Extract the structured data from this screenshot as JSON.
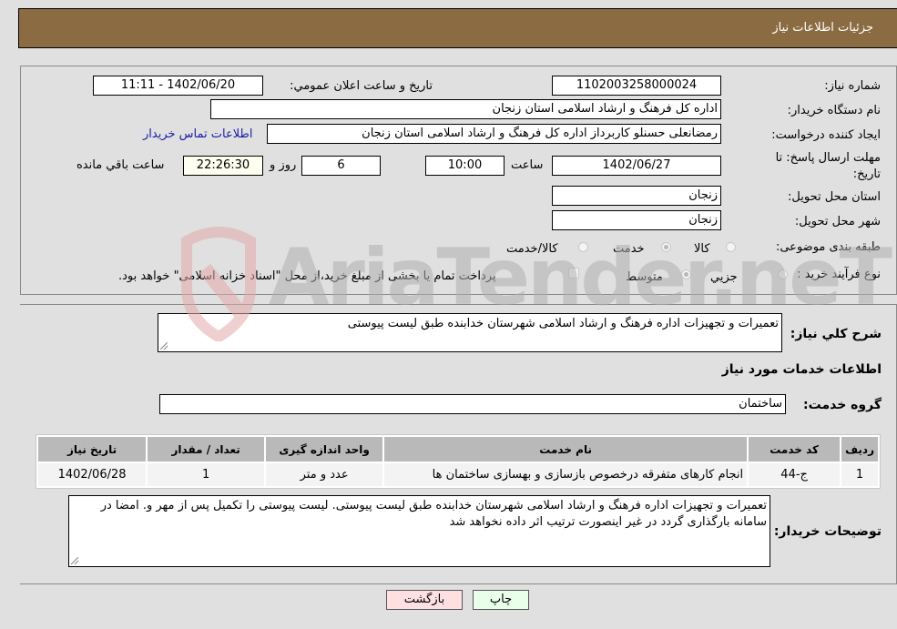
{
  "header": {
    "title": "جزئیات اطلاعات نیاز"
  },
  "form": {
    "need_number": {
      "label": "شماره نیاز:",
      "value": "1102003258000024"
    },
    "announce_datetime": {
      "label": "تاریخ و ساعت اعلان عمومي:",
      "value": "1402/06/20 - 11:11"
    },
    "buyer_org": {
      "label": "نام دستگاه خریدار:",
      "value": "اداره کل فرهنگ و ارشاد اسلامی استان زنجان"
    },
    "requester": {
      "label": "ایجاد کننده درخواست:",
      "value": "رمضانعلی حسنلو کاربرداز اداره کل فرهنگ و ارشاد اسلامی استان زنجان"
    },
    "buyer_contact_link": "اطلاعات تماس خریدار",
    "deadline": {
      "label": "مهلت ارسال پاسخ: تا تاریخ:",
      "date": "1402/06/27",
      "time_label": "ساعت",
      "time": "10:00",
      "days": "6",
      "days_label": "روز و",
      "remaining": "22:26:30",
      "remaining_label": "ساعت باقي مانده"
    },
    "province": {
      "label": "استان محل تحویل:",
      "value": "زنجان"
    },
    "city": {
      "label": "شهر محل تحویل:",
      "value": "زنجان"
    },
    "category": {
      "label": "طبقه بندی موضوعی:",
      "options": [
        {
          "label": "کالا",
          "checked": false
        },
        {
          "label": "خدمت",
          "checked": true
        },
        {
          "label": "کالا/خدمت",
          "checked": false
        }
      ]
    },
    "purchase_type": {
      "label": "نوع فرآیند خرید :",
      "options": [
        {
          "label": "جزيي",
          "checked": false
        },
        {
          "label": "متوسط",
          "checked": true
        }
      ],
      "treasury_note": "پرداخت تمام یا بخشی از مبلغ خرید،از محل \"اسناد خزانه اسلامی\" خواهد بود.",
      "treasury_checked": false
    }
  },
  "details": {
    "summary_label": "شرح کلي نياز:",
    "summary_value": "تعمیرات و تجهیزات اداره فرهنگ و ارشاد اسلامی شهرستان خدابنده طبق لیست پیوستی",
    "services_title": "اطلاعات خدمات مورد نیاز",
    "service_group_label": "گروه خدمت:",
    "service_group_value": "ساختمان",
    "table": {
      "headers": [
        "ردیف",
        "کد خدمت",
        "نام خدمت",
        "واحد اندازه گیری",
        "تعداد / مقدار",
        "تاریخ نیاز"
      ],
      "rows": [
        [
          "1",
          "ج-44",
          "انجام کارهای متفرقه درخصوص بازسازی و بهسازی ساختمان ها",
          "عدد و متر",
          "1",
          "1402/06/28"
        ]
      ]
    },
    "buyer_notes_label": "توضیحات خریدار:",
    "buyer_notes_value": "تعمیرات و تجهیزات اداره فرهنگ و ارشاد اسلامی شهرستان خدابنده طبق لیست پیوستی. لیست پیوستی را تکمیل پس از مهر و. امضا در سامانه بارگذاری گردد در غیر اینصورت ترتیب اثر داده نخواهد شد"
  },
  "buttons": {
    "print": "چاپ",
    "back": "بازگشت"
  },
  "watermark": {
    "text": "AriaTender.neT"
  }
}
